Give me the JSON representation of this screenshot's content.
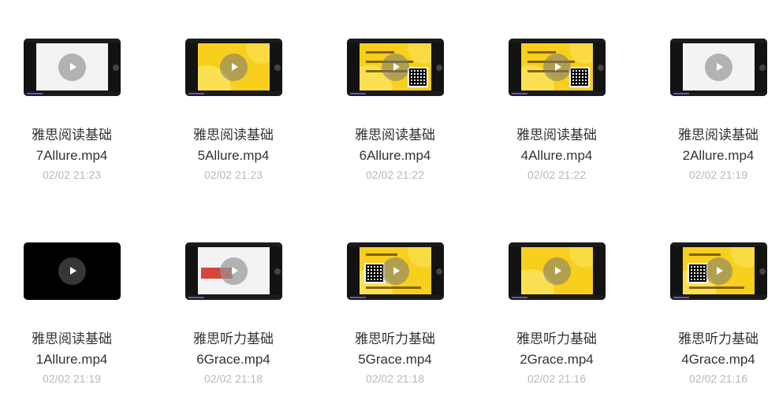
{
  "files": [
    {
      "title": "雅思阅读基础",
      "filename": "7Allure.mp4",
      "time": "02/02 21:23",
      "thumb": "white"
    },
    {
      "title": "雅思阅读基础",
      "filename": "5Allure.mp4",
      "time": "02/02 21:23",
      "thumb": "yellow"
    },
    {
      "title": "雅思阅读基础",
      "filename": "6Allure.mp4",
      "time": "02/02 21:22",
      "thumb": "yellow-qr"
    },
    {
      "title": "雅思阅读基础",
      "filename": "4Allure.mp4",
      "time": "02/02 21:22",
      "thumb": "yellow-qr"
    },
    {
      "title": "雅思阅读基础",
      "filename": "2Allure.mp4",
      "time": "02/02 21:19",
      "thumb": "white"
    },
    {
      "title": "雅思阅读基础",
      "filename": "1Allure.mp4",
      "time": "02/02 21:19",
      "thumb": "dark"
    },
    {
      "title": "雅思听力基础",
      "filename": "6Grace.mp4",
      "time": "02/02 21:18",
      "thumb": "white-red"
    },
    {
      "title": "雅思听力基础",
      "filename": "5Grace.mp4",
      "time": "02/02 21:18",
      "thumb": "yellow-qr-left"
    },
    {
      "title": "雅思听力基础",
      "filename": "2Grace.mp4",
      "time": "02/02 21:16",
      "thumb": "yellow"
    },
    {
      "title": "雅思听力基础",
      "filename": "4Grace.mp4",
      "time": "02/02 21:16",
      "thumb": "yellow-qr-left"
    }
  ],
  "icons": {
    "play": "play-icon"
  }
}
